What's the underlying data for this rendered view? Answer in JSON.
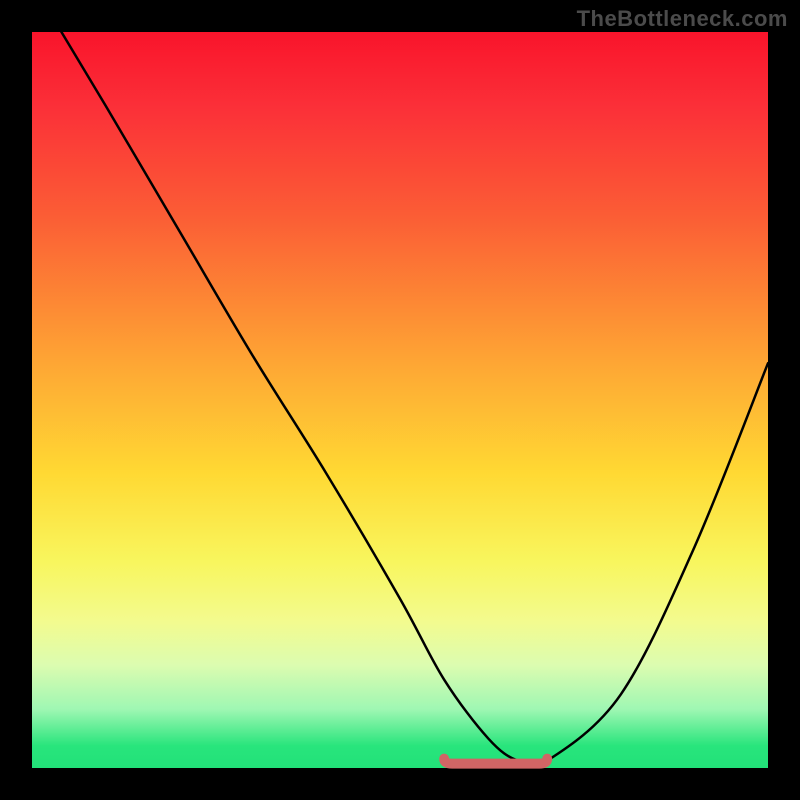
{
  "watermark": "TheBottleneck.com",
  "colors": {
    "frame": "#000000",
    "gradient_top": "#f9142b",
    "gradient_mid1": "#fea634",
    "gradient_mid2": "#ffd933",
    "gradient_bottom": "#22e179",
    "curve": "#000000",
    "flat_segment": "#d16565"
  },
  "chart_data": {
    "type": "line",
    "title": "",
    "xlabel": "",
    "ylabel": "",
    "xlim": [
      0,
      100
    ],
    "ylim": [
      0,
      100
    ],
    "grid": false,
    "series": [
      {
        "name": "curve",
        "x": [
          4,
          10,
          20,
          30,
          40,
          50,
          56,
          62,
          66,
          70,
          80,
          90,
          100
        ],
        "y": [
          100,
          90,
          73,
          56,
          40,
          23,
          12,
          4,
          1,
          1,
          10,
          30,
          55
        ]
      }
    ],
    "flat_segment": {
      "x_start": 56,
      "x_end": 70,
      "y": 1
    }
  }
}
